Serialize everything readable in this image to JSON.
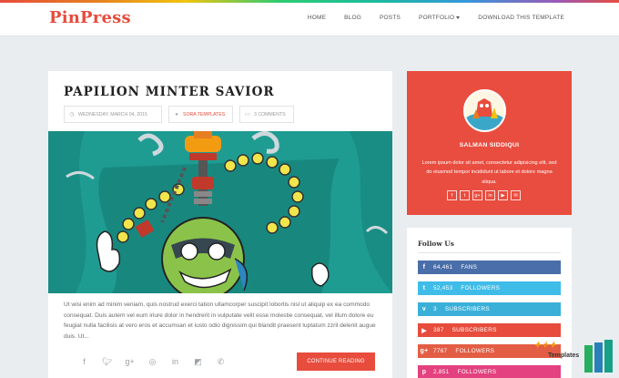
{
  "site": {
    "logo": "PinPress"
  },
  "nav": {
    "home": "HOME",
    "blog": "BLOG",
    "posts": "POSTS",
    "portfolio": "PORTFOLIO",
    "download": "DOWNLOAD THIS TEMPLATE"
  },
  "post": {
    "title": "PAPILION MINTER SAVIOR",
    "date": "WEDNESDAY, MARCH 04, 2015",
    "author": "SORA TEMPLATES",
    "comments": "3 COMMENTS",
    "excerpt": "Ut wisi enim ad minim veniam, quis nostrud exerci tation ullamcorper suscipit lobortis nisl ut aliquip ex ea commodo consequat. Duis autem vel eum iriure dolor in hendrerit in vulputate velit esse molestie consequat, vel illum dolore eu feugiat nulla facilisis at vero eros et accumsan et iusto odio dignissim qui blandit praesent luptatum zzril delenit augue duis. Ut...",
    "continue_label": "CONTINUE READING",
    "share_icons": [
      "facebook-icon",
      "twitter-icon",
      "google-plus-icon",
      "reddit-icon",
      "linkedin-icon",
      "delicious-icon",
      "whatsapp-icon"
    ]
  },
  "author_widget": {
    "name": "SALMAN SIDDIQUI",
    "bio": "Lorem ipsum dolor sit amet, consectetur adipisicing elit, sed do eiusmod tempor incididunt ut labore et dolore magna aliqua.",
    "social_icons": [
      "facebook-icon",
      "twitter-icon",
      "google-plus-icon",
      "linkedin-icon",
      "youtube-icon",
      "email-icon"
    ],
    "bg_color": "#e94d3f"
  },
  "follow_widget": {
    "heading": "Follow Us",
    "items": [
      {
        "count": "64,461",
        "label": "FANS",
        "icon": "facebook-icon",
        "color": "#4a6ea9"
      },
      {
        "count": "52,453",
        "label": "FOLLOWERS",
        "icon": "twitter-icon",
        "color": "#3fbde8"
      },
      {
        "count": "3",
        "label": "SUBSCRIBERS",
        "icon": "vimeo-icon",
        "color": "#3ab0d9"
      },
      {
        "count": "387",
        "label": "SUBSCRIBERS",
        "icon": "youtube-icon",
        "color": "#e74c3c"
      },
      {
        "count": "7767",
        "label": "FOLLOWERS",
        "icon": "google-plus-icon",
        "color": "#e35d44"
      },
      {
        "count": "2,851",
        "label": "FOLLOWERS",
        "icon": "pinterest-icon",
        "color": "#e3417f"
      }
    ]
  },
  "watermark": {
    "text": "Templates"
  },
  "colors": {
    "accent": "#e74c3c",
    "hero_bg": "#1f9c92"
  }
}
